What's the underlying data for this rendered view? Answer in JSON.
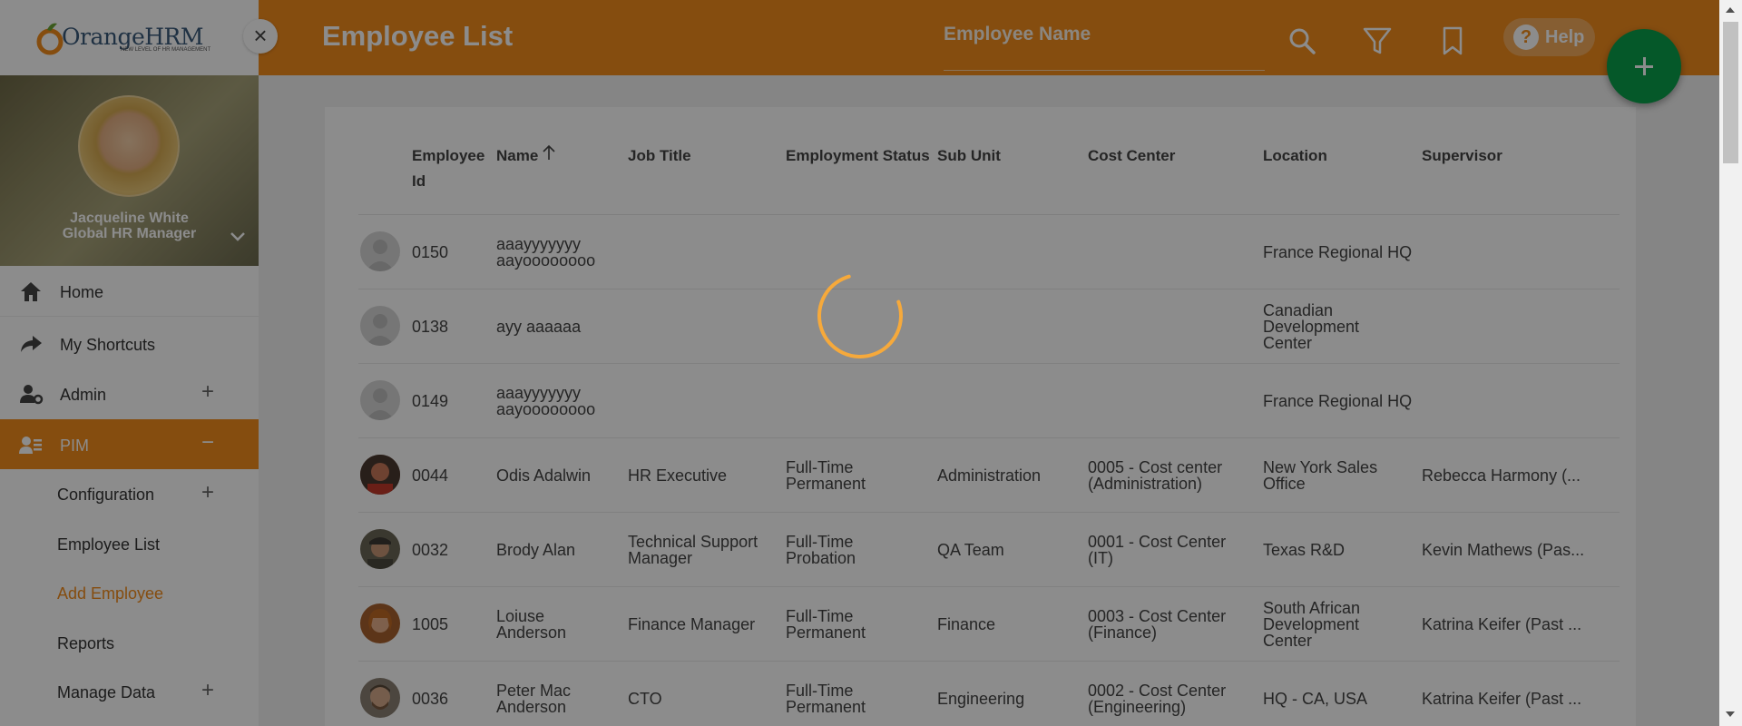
{
  "header": {
    "title": "Employee List",
    "search_placeholder": "Employee Name",
    "help_label": "Help"
  },
  "sidebar": {
    "logo_text": "OrangeHRM",
    "logo_tagline": "NEW LEVEL OF HR MANAGEMENT",
    "user_name": "Jacqueline White",
    "user_role": "Global HR Manager",
    "items": [
      {
        "label": "Home"
      },
      {
        "label": "My Shortcuts"
      },
      {
        "label": "Admin"
      },
      {
        "label": "PIM"
      }
    ],
    "pim_sub": [
      {
        "label": "Configuration"
      },
      {
        "label": "Employee List"
      },
      {
        "label": "Add Employee"
      },
      {
        "label": "Reports"
      },
      {
        "label": "Manage Data"
      }
    ]
  },
  "table": {
    "headers": {
      "id_line1": "Employee",
      "id_line2": "Id",
      "name": "Name",
      "job_title": "Job Title",
      "status": "Employment Status",
      "sub_unit": "Sub Unit",
      "cost_center": "Cost Center",
      "location": "Location",
      "supervisor": "Supervisor"
    },
    "rows": [
      {
        "id": "0150",
        "name1": "aaayyyyyyy",
        "name2": "aayoooooooo",
        "job": "",
        "job2": "",
        "status1": "",
        "status2": "",
        "unit": "",
        "cc1": "",
        "cc2": "",
        "loc1": "France Regional HQ",
        "loc2": "",
        "loc3": "",
        "sup": ""
      },
      {
        "id": "0138",
        "name1": "ayy aaaaaa",
        "name2": "",
        "job": "",
        "job2": "",
        "status1": "",
        "status2": "",
        "unit": "",
        "cc1": "",
        "cc2": "",
        "loc1": "Canadian",
        "loc2": "Development",
        "loc3": "Center",
        "sup": ""
      },
      {
        "id": "0149",
        "name1": "aaayyyyyyy",
        "name2": "aayoooooooo",
        "job": "",
        "job2": "",
        "status1": "",
        "status2": "",
        "unit": "",
        "cc1": "",
        "cc2": "",
        "loc1": "France Regional HQ",
        "loc2": "",
        "loc3": "",
        "sup": ""
      },
      {
        "id": "0044",
        "name1": "Odis Adalwin",
        "name2": "",
        "job": "HR Executive",
        "job2": "",
        "status1": "Full-Time",
        "status2": "Permanent",
        "unit": "Administration",
        "cc1": "0005 - Cost center",
        "cc2": "(Administration)",
        "loc1": "New York Sales",
        "loc2": "Office",
        "loc3": "",
        "sup": "Rebecca Harmony (..."
      },
      {
        "id": "0032",
        "name1": "Brody Alan",
        "name2": "",
        "job": "Technical Support",
        "job2": "Manager",
        "status1": "Full-Time",
        "status2": "Probation",
        "unit": "QA Team",
        "cc1": "0001 - Cost Center",
        "cc2": "(IT)",
        "loc1": "Texas R&D",
        "loc2": "",
        "loc3": "",
        "sup": "Kevin Mathews (Pas..."
      },
      {
        "id": "1005",
        "name1": "Loiuse",
        "name2": "Anderson",
        "job": "Finance Manager",
        "job2": "",
        "status1": "Full-Time",
        "status2": "Permanent",
        "unit": "Finance",
        "cc1": "0003 - Cost Center",
        "cc2": "(Finance)",
        "loc1": "South African",
        "loc2": "Development",
        "loc3": "Center",
        "sup": "Katrina Keifer (Past ..."
      },
      {
        "id": "0036",
        "name1": "Peter Mac",
        "name2": "Anderson",
        "job": "CTO",
        "job2": "",
        "status1": "Full-Time",
        "status2": "Permanent",
        "unit": "Engineering",
        "cc1": "0002 - Cost Center",
        "cc2": "(Engineering)",
        "loc1": "HQ - CA, USA",
        "loc2": "",
        "loc3": "",
        "sup": "Katrina Keifer (Past ..."
      }
    ]
  },
  "colors": {
    "brand": "#f28c1d",
    "fab": "#0aa14b",
    "spinner": "#f6a93b"
  }
}
